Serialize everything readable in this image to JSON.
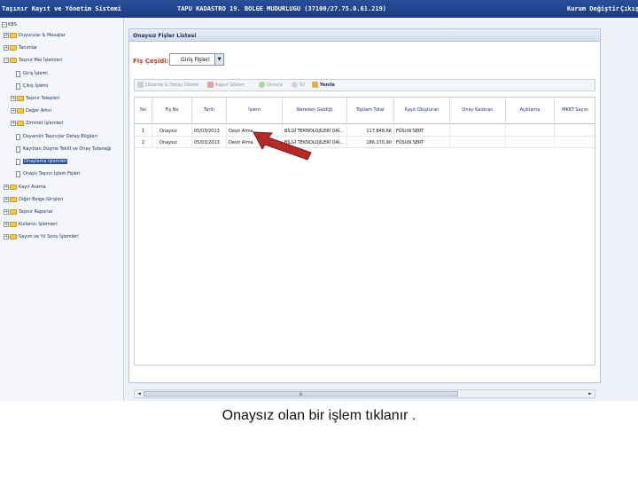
{
  "topbar": {
    "title": "Taşınır Kayıt ve Yönetim Sistemi",
    "server": "TAPU KADASTRO 19. BOLGE MUDURLUGU (37100/27.75.0.61.219)",
    "kurum_degistir": "Kurum Değiştir",
    "cikis": "Çıkış"
  },
  "sidebar": {
    "items": [
      {
        "label": "KBS"
      },
      {
        "label": "Duyurular & Mesajlar"
      },
      {
        "label": "Tanımlar"
      },
      {
        "label": "Taşınır Mal İşlemleri"
      },
      {
        "label": "Giriş İşlemi"
      },
      {
        "label": "Çıkış İşlemi"
      },
      {
        "label": "Taşınır Talepleri"
      },
      {
        "label": "Değer Artırı"
      },
      {
        "label": "Zimmet İşlemleri"
      },
      {
        "label": "Dayanıklı Taşınırlar Detay Bilgileri"
      },
      {
        "label": "Kayıttan Düşme Teklif ve Onay Tutanağı"
      },
      {
        "label": "Onaylama İşlemleri"
      },
      {
        "label": "Onaylı Taşınır İşlem Fişleri"
      },
      {
        "label": "Kayıt Arama"
      },
      {
        "label": "Diğer Belge Girişleri"
      },
      {
        "label": "Taşınır Raporlar"
      },
      {
        "label": "Kullanıcı İşlemleri"
      },
      {
        "label": "Sayım ve Yıl Sonu İşlemleri"
      }
    ]
  },
  "main": {
    "tab_title": "Onaysız Fişler Listesi",
    "filter_label": "Fiş Çeşidi:",
    "filter_value": "Giriş Fişleri",
    "toolbar": {
      "edit": "Düzenle & Detay Göster",
      "report": "Rapor Göster",
      "approve": "Onayla",
      "delete": "Sil",
      "refresh": "Yenile"
    },
    "columns": [
      "No",
      "Fiş No",
      "Tarih",
      "İşlem",
      "Nereden Geldiği",
      "Toplam Tutar",
      "Kayıt Oluşturan",
      "Onay Kaldıran",
      "Açıklama",
      "MKKT Sayısı"
    ],
    "rows": [
      [
        "1",
        "Onaysız",
        "05/03/2013",
        "Devir Alma",
        "BİLGİ TEKNOLOJİLERİ DAİ...",
        "117.848,66",
        "FÜSUN SERT",
        "",
        "",
        ""
      ],
      [
        "2",
        "Onaysız",
        "05/03/2013",
        "Devir Alma",
        "BİLGİ TEKNOLOJİLERİ DAİ...",
        "186.170,90",
        "FÜSUN SERT",
        "",
        "",
        ""
      ]
    ],
    "scroll_label": "III"
  },
  "colors": {
    "topbar": "#1b3a7e",
    "accent_red": "#c0392b",
    "arrow_red": "#b42a2a"
  },
  "caption": "Onaysız olan bir işlem tıklanır ."
}
